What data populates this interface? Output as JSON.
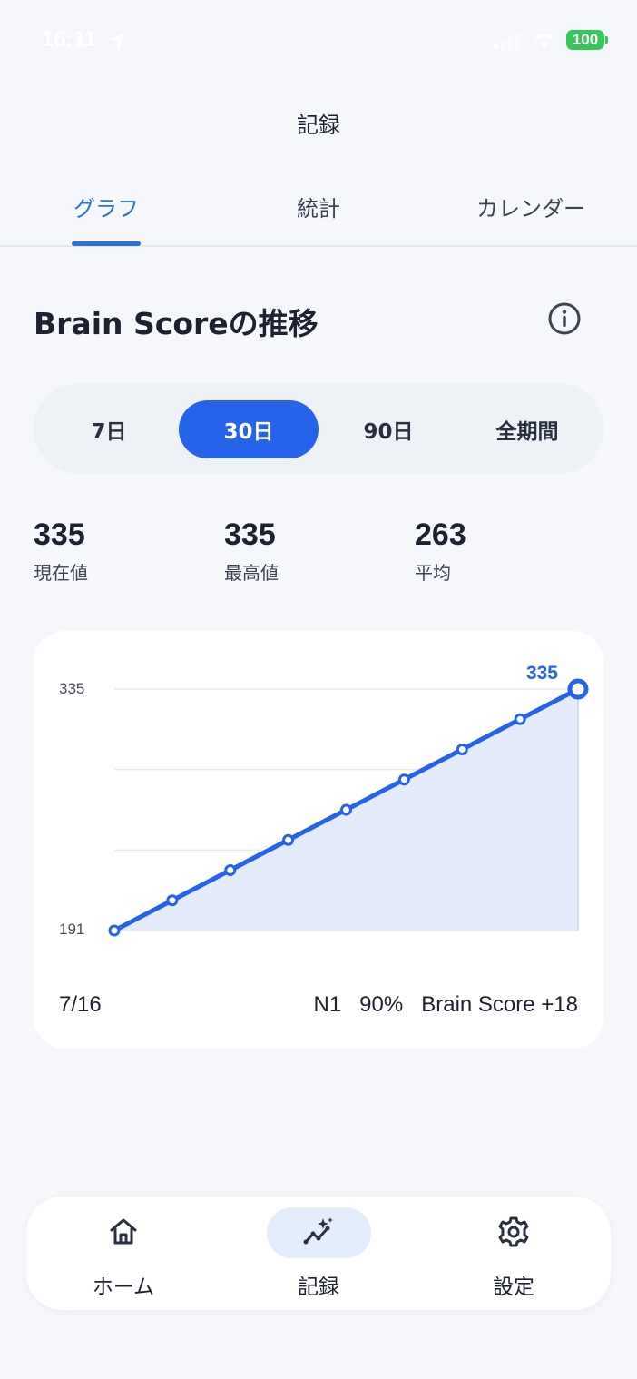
{
  "status_bar": {
    "time": "16:11",
    "battery": "100"
  },
  "header": {
    "title": "記録"
  },
  "tabs": [
    {
      "label": "グラフ",
      "active": true
    },
    {
      "label": "統計",
      "active": false
    },
    {
      "label": "カレンダー",
      "active": false
    }
  ],
  "section": {
    "title": "Brain Scoreの推移"
  },
  "ranges": [
    {
      "label": "7日",
      "active": false
    },
    {
      "label": "30日",
      "active": true
    },
    {
      "label": "90日",
      "active": false
    },
    {
      "label": "全期間",
      "active": false
    }
  ],
  "stats": [
    {
      "value": "335",
      "label": "現在値"
    },
    {
      "value": "335",
      "label": "最高値"
    },
    {
      "value": "263",
      "label": "平均"
    }
  ],
  "chart_data": {
    "type": "area",
    "series": [
      {
        "values": [
          191,
          209,
          227,
          245,
          263,
          281,
          299,
          317,
          335
        ]
      }
    ],
    "ylim": [
      191,
      335
    ],
    "y_tick_labels": [
      "335",
      "191"
    ],
    "highlight_label": "335",
    "grid": true
  },
  "chart_footer": {
    "date": "7/16",
    "detail": "N1   90%   Brain Score +18"
  },
  "bottom_nav": [
    {
      "label": "ホーム",
      "icon": "home-icon",
      "active": false
    },
    {
      "label": "記録",
      "icon": "chart-sparkle-icon",
      "active": true
    },
    {
      "label": "設定",
      "icon": "gear-icon",
      "active": false
    }
  ],
  "colors": {
    "accent": "#2563eb",
    "tab_active": "#2b6fe0",
    "area_fill": "#e4ebfb",
    "battery": "#34c759"
  }
}
